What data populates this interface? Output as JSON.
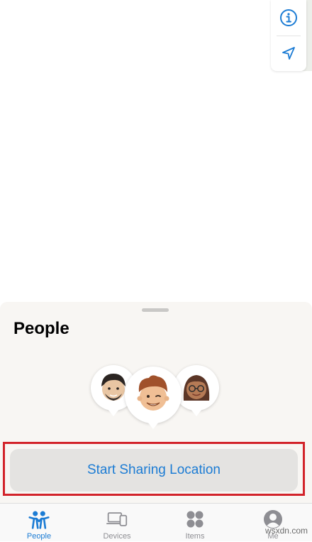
{
  "map": {
    "controls": [
      {
        "icon": "info-icon",
        "accent": "#1c7cd4"
      },
      {
        "icon": "location-arrow-icon",
        "accent": "#1c7cd4"
      }
    ]
  },
  "sheet": {
    "title": "People",
    "avatars": [
      "memoji-bearded-man",
      "memoji-smiling-man",
      "memoji-woman-with-glasses"
    ],
    "primary_action": "Start Sharing Location"
  },
  "tabbar": {
    "active_color": "#1c7cd4",
    "inactive_color": "#8e8e93",
    "tabs": [
      {
        "label": "People",
        "icon": "people-icon",
        "active": true
      },
      {
        "label": "Devices",
        "icon": "devices-icon",
        "active": false
      },
      {
        "label": "Items",
        "icon": "items-icon",
        "active": false
      },
      {
        "label": "Me",
        "icon": "person-circle-icon",
        "active": false
      }
    ]
  },
  "watermark": "wsxdn.com"
}
